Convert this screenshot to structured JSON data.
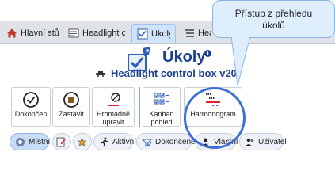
{
  "tabs": [
    {
      "label": "Hlavní stůl",
      "icon": "home-icon"
    },
    {
      "label": "Headlight co...",
      "icon": "document-icon"
    },
    {
      "label": "Úkoly",
      "icon": "tasks-icon",
      "active": true
    },
    {
      "label": "Headl",
      "icon": "list-icon"
    }
  ],
  "header": {
    "title": "Úkoly",
    "info": "i",
    "subtitle": "Headlight control box v20"
  },
  "ribbon": {
    "buttons": [
      {
        "label": "Dokončen",
        "icon": "check-circle-icon"
      },
      {
        "label": "Zastavit",
        "icon": "stop-icon"
      },
      {
        "label": "Hromadně upravit",
        "icon": "bulk-edit-icon"
      },
      {
        "label": "Kanban pohled",
        "icon": "kanban-icon"
      },
      {
        "label": "Harmonogram",
        "icon": "gantt-icon"
      }
    ]
  },
  "filters": [
    {
      "label": "Místní",
      "icon": "scope-icon",
      "selected": true
    },
    {
      "label": "",
      "icon": "edit-filter-icon"
    },
    {
      "label": "",
      "icon": "favorite-filter-icon"
    },
    {
      "label": "Aktivní",
      "icon": "runner-icon"
    },
    {
      "label": "Dokončené",
      "icon": "done-filter-icon"
    },
    {
      "label": "Vlastní",
      "icon": "person-icon"
    },
    {
      "label": "Uživatel",
      "icon": "users-icon"
    }
  ],
  "callout": {
    "text_line1": "Přístup z přehledu",
    "text_line2": "úkolů"
  },
  "colors": {
    "accent": "#1c3f94",
    "highlight": "#3d6fd6",
    "callout_bg": "#dfeefc"
  }
}
